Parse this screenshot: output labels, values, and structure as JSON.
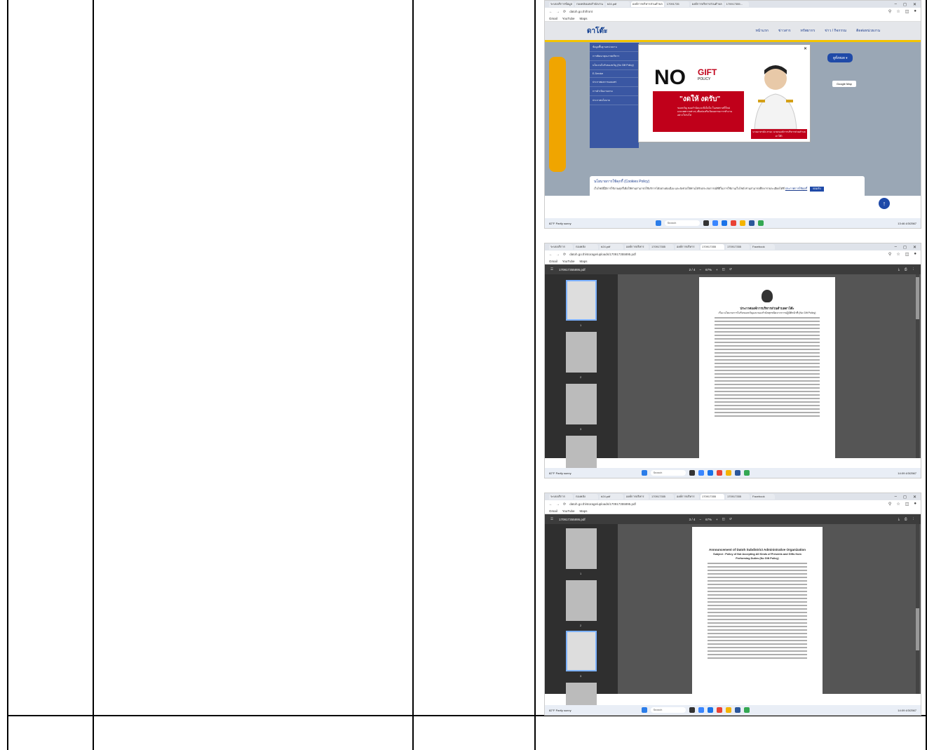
{
  "shot1": {
    "tabs": [
      "ระบบบริการข้อมูล",
      "กองคลังแห่งสำนักงาน",
      "b24.pdf",
      "องค์การบริหารส่วนตำบล",
      "17091735",
      "องค์การบริหารส่วนตำบล",
      "170917355..."
    ],
    "url": "datoh.go.th/front",
    "bookmarks": [
      "Gmail",
      "YouTube",
      "Maps"
    ],
    "site_nav": [
      "หน้าแรก",
      "ข่าวสาร",
      "ทรัพยากร",
      "ข่าว / กิจกรรม",
      "ติดต่อหน่วยงาน"
    ],
    "site_logo": "ดาโต๊ะ",
    "menu": [
      "ข้อมูลพื้นฐานหน่วยงาน",
      "การพัฒนาคุณภาพบริหาร",
      "นโยบายไม่รับของขวัญ (No Gift Policy)",
      "E-Service",
      "ประกาศผลการเผยแพร่",
      "การดำเนินงานตาม",
      "ประกาศนโยบาย"
    ],
    "popup_no": "NO",
    "popup_gift": "GIFT",
    "popup_policy": "POLICY",
    "popup_slogan": "\"งดให้ งดรับ\"",
    "popup_sub": "ของขวัญ ของกำนัลและสิ่งใดใด ในเทศกาลปีใหม่ และเทศกาลต่างๆ เพื่อส่งเสริมวัฒนธรรมการทำงานอย่างโปร่งใส",
    "popup_person": "นายอาหามัด สามะ นายกองค์การบริหารส่วนตำบลดาโต๊ะ",
    "nav_button": "ดูทั้งหมด ▾",
    "map_buttons": [
      "Google Map"
    ],
    "cookie_title": "นโยบายการใช้คุกกี้ (Cookies Policy)",
    "cookie_text": "เว็บไซต์นี้มีการใช้งานคุกกี้เพื่อให้ท่านสามารถใช้บริการได้อย่างต่อเนื่อง และยังช่วยให้ท่านได้รับประสบการณ์ที่ดีในการใช้งานเว็บไซต์ ท่านสามารถศึกษารายละเอียดได้ที่",
    "cookie_link": "ประกาศการใช้คุกกี้",
    "cookie_btn": "ยอมรับ",
    "weather": "82°F Partly sunny",
    "search": "Search",
    "clock": "13:46 4/3/2567"
  },
  "shot2": {
    "tabs": [
      "ระบบบริการ",
      "กองคลัง",
      "b24.pdf",
      "องค์การบริหาร",
      "170917355",
      "องค์การบริหาร",
      "170917355",
      "170917355",
      "Facebook"
    ],
    "url": "datoh.go.th/storage/uploads/170917355895.pdf",
    "bookmarks": [
      "Gmail",
      "YouTube",
      "Maps"
    ],
    "filename": "170917355895.pdf",
    "page_ind": "2 / 4",
    "zoom": "67%",
    "thumb_nums": [
      "1",
      "2",
      "3"
    ],
    "page_title": "ประกาศองค์การบริหารส่วนตำบลดาโต๊ะ",
    "page_subtitle": "เรื่อง นโยบายการไม่รับของขวัญและของกำนัลทุกชนิดจากการปฏิบัติหน้าที่ (No Gift Policy)",
    "weather": "82°F Partly sunny",
    "search": "Search",
    "clock": "14:09 4/3/2567"
  },
  "shot3": {
    "tabs": [
      "ระบบบริการ",
      "กองคลัง",
      "b24.pdf",
      "องค์การบริหาร",
      "170917355",
      "องค์การบริหาร",
      "170917355",
      "170917355",
      "Facebook"
    ],
    "url": "datoh.go.th/storage/uploads/170917355895.pdf",
    "bookmarks": [
      "Gmail",
      "YouTube",
      "Maps"
    ],
    "filename": "170917355895.pdf",
    "page_ind": "3 / 4",
    "zoom": "67%",
    "thumb_nums": [
      "1",
      "2",
      "3"
    ],
    "page_title": "Announcement of Datoh Subdistrict Administrative Organization",
    "page_subtitle": "Subject : Policy of Not Accepting All Kinds of Presents and Gifts from Performing Duties (No Gift Policy)",
    "weather": "82°F Partly sunny",
    "search": "Search",
    "clock": "14:09 4/3/2567"
  }
}
